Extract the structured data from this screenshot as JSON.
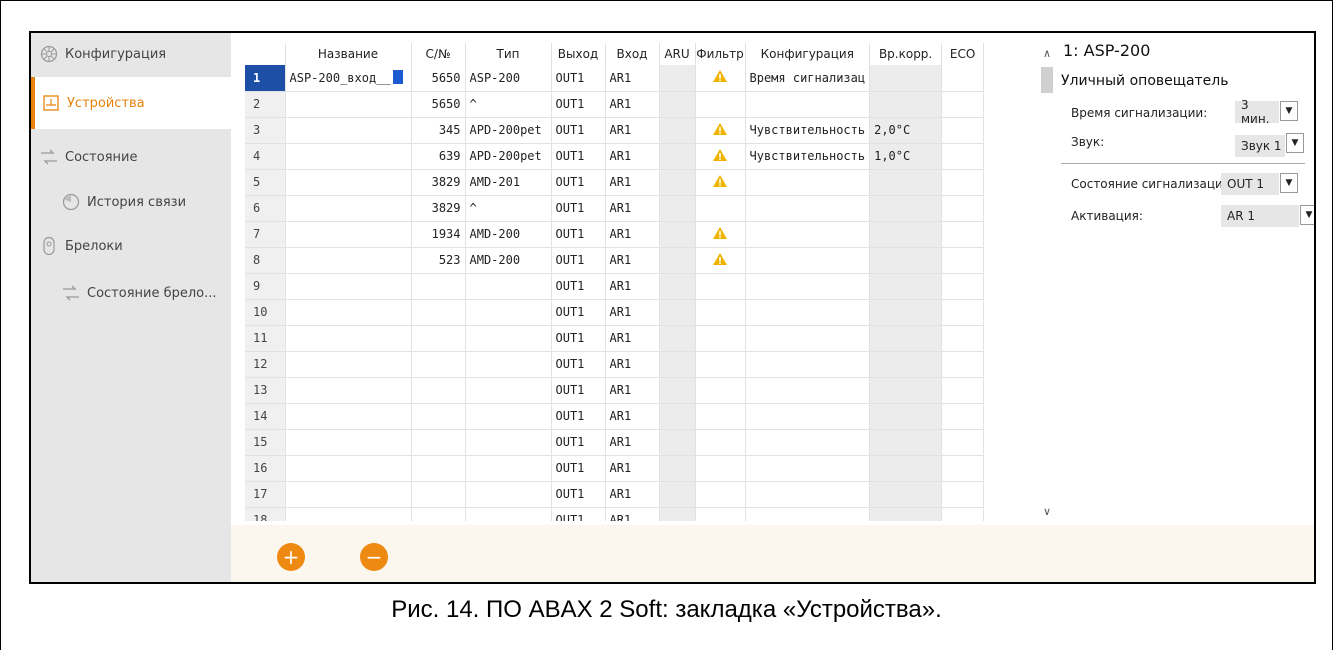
{
  "sidebar": {
    "items": [
      {
        "label": "Конфигурация",
        "icon": "configuration-icon"
      },
      {
        "label": "Устройства",
        "icon": "devices-icon",
        "active": true
      },
      {
        "label": "Состояние",
        "icon": "status-icon"
      },
      {
        "label": "История связи",
        "icon": "connection-history-icon"
      },
      {
        "label": "Брелоки",
        "icon": "keyfobs-icon"
      },
      {
        "label": "Состояние брело...",
        "icon": "keyfob-status-icon"
      }
    ]
  },
  "grid": {
    "columns": [
      "",
      "Название",
      "С/№",
      "Тип",
      "Выход",
      "Вход",
      "ARU",
      "Фильтр",
      "Конфигурация",
      "Вр.корр.",
      "ECO"
    ],
    "rows": [
      {
        "num": "1",
        "name": "ASP-200_вход__",
        "sn": "5650",
        "type": "ASP-200",
        "out": "OUT1",
        "in": "AR1",
        "warn": true,
        "config": "Время сигнализац",
        "corr": ""
      },
      {
        "num": "2",
        "name": "",
        "sn": "5650",
        "type": "^",
        "out": "OUT1",
        "in": "AR1",
        "warn": false,
        "config": "",
        "corr": ""
      },
      {
        "num": "3",
        "name": "",
        "sn": "345",
        "type": "APD-200pet",
        "out": "OUT1",
        "in": "AR1",
        "warn": true,
        "config": "Чувствительность",
        "corr": "2,0°C"
      },
      {
        "num": "4",
        "name": "",
        "sn": "639",
        "type": "APD-200pet",
        "out": "OUT1",
        "in": "AR1",
        "warn": true,
        "config": "Чувствительность",
        "corr": "1,0°C"
      },
      {
        "num": "5",
        "name": "",
        "sn": "3829",
        "type": "AMD-201",
        "out": "OUT1",
        "in": "AR1",
        "warn": true,
        "config": "",
        "corr": ""
      },
      {
        "num": "6",
        "name": "",
        "sn": "3829",
        "type": "^",
        "out": "OUT1",
        "in": "AR1",
        "inMuted": true,
        "warn": false,
        "config": "",
        "corr": ""
      },
      {
        "num": "7",
        "name": "",
        "sn": "1934",
        "type": "AMD-200",
        "out": "OUT1",
        "in": "AR1",
        "warn": true,
        "config": "",
        "corr": ""
      },
      {
        "num": "8",
        "name": "",
        "sn": "523",
        "type": "AMD-200",
        "out": "OUT1",
        "in": "AR1",
        "warn": true,
        "config": "",
        "corr": ""
      },
      {
        "num": "9",
        "empty": true,
        "out": "OUT1",
        "in": "AR1"
      },
      {
        "num": "10",
        "empty": true,
        "out": "OUT1",
        "in": "AR1"
      },
      {
        "num": "11",
        "empty": true,
        "out": "OUT1",
        "in": "AR1"
      },
      {
        "num": "12",
        "empty": true,
        "out": "OUT1",
        "in": "AR1"
      },
      {
        "num": "13",
        "empty": true,
        "out": "OUT1",
        "in": "AR1"
      },
      {
        "num": "14",
        "empty": true,
        "out": "OUT1",
        "in": "AR1"
      },
      {
        "num": "15",
        "empty": true,
        "out": "OUT1",
        "in": "AR1"
      },
      {
        "num": "16",
        "empty": true,
        "out": "OUT1",
        "in": "AR1"
      },
      {
        "num": "17",
        "empty": true,
        "out": "OUT1",
        "in": "AR1"
      },
      {
        "num": "18",
        "empty": true,
        "out": "OUT1",
        "in": "AR1"
      }
    ]
  },
  "panel": {
    "title": "1: ASP-200",
    "subtitle": "Уличный оповещатель",
    "alarm_time_label": "Время сигнализации:",
    "alarm_time_value": "3 мин.",
    "sound_label": "Звук:",
    "sound_value": "Звук 1",
    "alarm_state_label": "Состояние сигнализаци",
    "alarm_state_value": "OUT 1",
    "activation_label": "Активация:",
    "activation_value": "AR 1"
  },
  "caption": "Рис. 14. ПО ABAX 2 Soft: закладка «Устройства».",
  "colors": {
    "accent": "#ee8a12",
    "selection": "#1e4fa6"
  }
}
